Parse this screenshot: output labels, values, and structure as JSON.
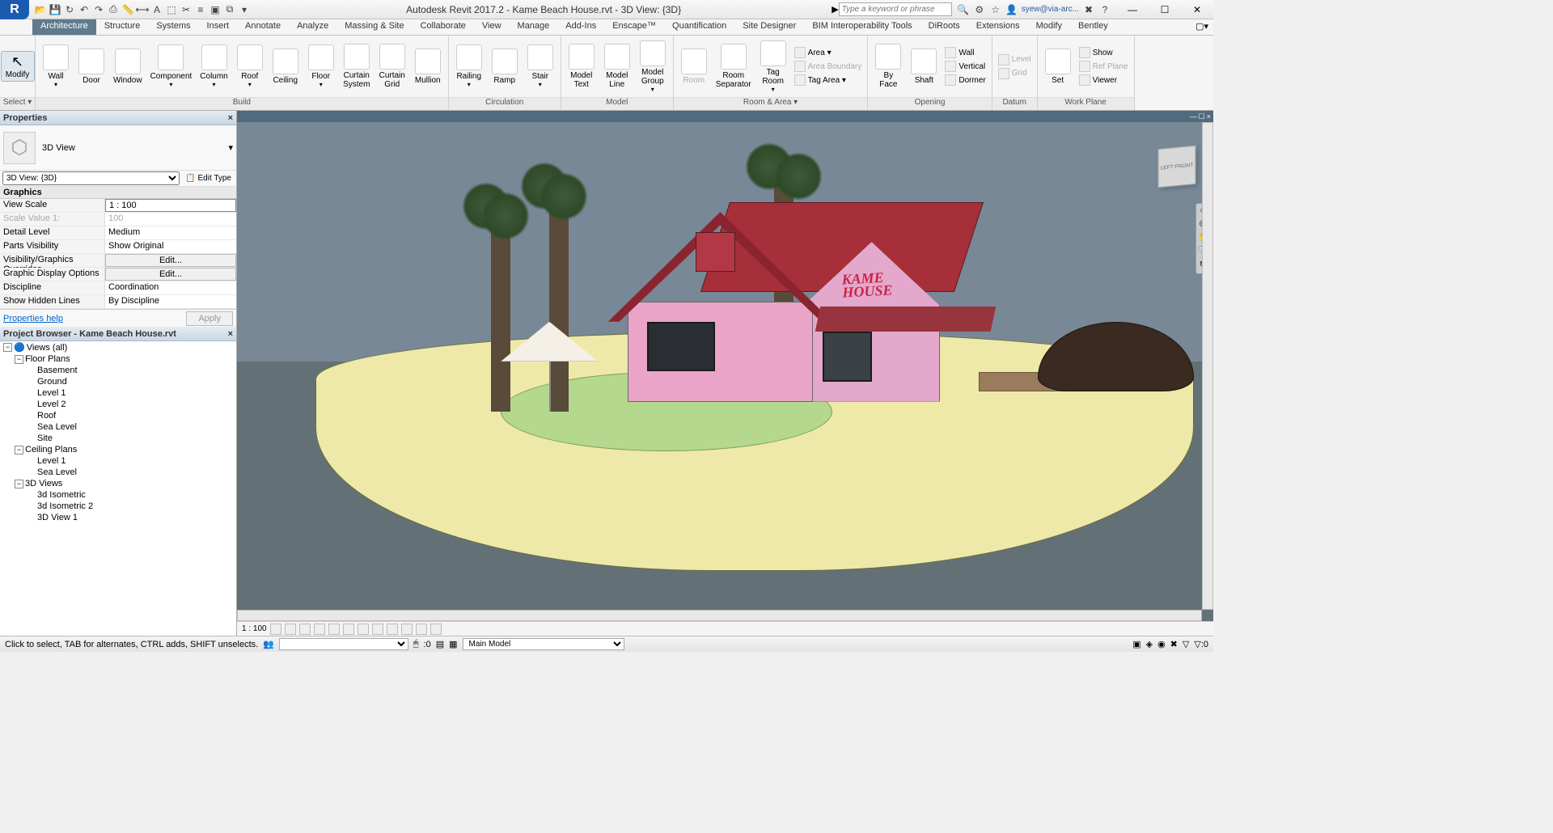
{
  "title": "Autodesk Revit 2017.2 -     Kame Beach House.rvt - 3D View: {3D}",
  "search_placeholder": "Type a keyword or phrase",
  "user": "syew@via-arc...",
  "ribbon_tabs": [
    "Architecture",
    "Structure",
    "Systems",
    "Insert",
    "Annotate",
    "Analyze",
    "Massing & Site",
    "Collaborate",
    "View",
    "Manage",
    "Add-Ins",
    "Enscape™",
    "Quantification",
    "Site Designer",
    "BIM Interoperability Tools",
    "DiRoots",
    "Extensions",
    "Modify",
    "Bentley"
  ],
  "ribbon_active_tab": "Architecture",
  "ribbon": {
    "select": {
      "modify": "Modify",
      "select": "Select ▾",
      "panel": "Select"
    },
    "build": {
      "title": "Build",
      "items": [
        "Wall",
        "Door",
        "Window",
        "Component",
        "Column",
        "Roof",
        "Ceiling",
        "Floor",
        "Curtain\nSystem",
        "Curtain\nGrid",
        "Mullion"
      ]
    },
    "circulation": {
      "title": "Circulation",
      "items": [
        "Railing",
        "Ramp",
        "Stair"
      ]
    },
    "model": {
      "title": "Model",
      "items": [
        "Model\nText",
        "Model\nLine",
        "Model\nGroup"
      ]
    },
    "room_area": {
      "title": "Room & Area ▾",
      "big": [
        "Room",
        "Room\nSeparator",
        "Tag\nRoom"
      ],
      "small": [
        "Area ▾",
        "Area Boundary",
        "Tag Area ▾"
      ]
    },
    "opening": {
      "title": "Opening",
      "big": [
        "By\nFace",
        "Shaft"
      ],
      "small": [
        "Wall",
        "Vertical",
        "Dormer"
      ]
    },
    "datum": {
      "title": "Datum",
      "big": [
        "Set"
      ],
      "small": [
        "Level",
        "Grid"
      ]
    },
    "workplane": {
      "title": "Work Plane",
      "small": [
        "Show",
        "Ref Plane",
        "Viewer"
      ]
    }
  },
  "properties": {
    "title": "Properties",
    "type_name": "3D View",
    "instance_dd": "3D View: {3D}",
    "edit_type": "Edit Type",
    "group": "Graphics",
    "rows": [
      {
        "n": "View Scale",
        "v": "1 : 100",
        "boxed": true
      },
      {
        "n": "Scale Value    1:",
        "v": "100"
      },
      {
        "n": "Detail Level",
        "v": "Medium"
      },
      {
        "n": "Parts Visibility",
        "v": "Show Original"
      },
      {
        "n": "Visibility/Graphics Overrides",
        "v": "Edit...",
        "btn": true
      },
      {
        "n": "Graphic Display Options",
        "v": "Edit...",
        "btn": true
      },
      {
        "n": "Discipline",
        "v": "Coordination"
      },
      {
        "n": "Show Hidden Lines",
        "v": "By Discipline"
      }
    ],
    "help": "Properties help",
    "apply": "Apply"
  },
  "browser": {
    "title": "Project Browser - Kame Beach House.rvt",
    "root": "Views (all)",
    "floor_plans": {
      "label": "Floor Plans",
      "items": [
        "Basement",
        "Ground",
        "Level 1",
        "Level 2",
        "Roof",
        "Sea Level",
        "Site"
      ]
    },
    "ceiling_plans": {
      "label": "Ceiling Plans",
      "items": [
        "Level 1",
        "Sea Level"
      ]
    },
    "views3d": {
      "label": "3D Views",
      "items": [
        "3d Isometric",
        "3d Isometric 2",
        "3D View 1"
      ]
    }
  },
  "view_scale": "1 : 100",
  "status_msg": "Click to select, TAB for alternates, CTRL adds, SHIFT unselects.",
  "status_sel": ":0",
  "status_model": "Main Model",
  "kame_text": "KAME\nHOUSE",
  "viewcube": "LEFT  FRONT"
}
